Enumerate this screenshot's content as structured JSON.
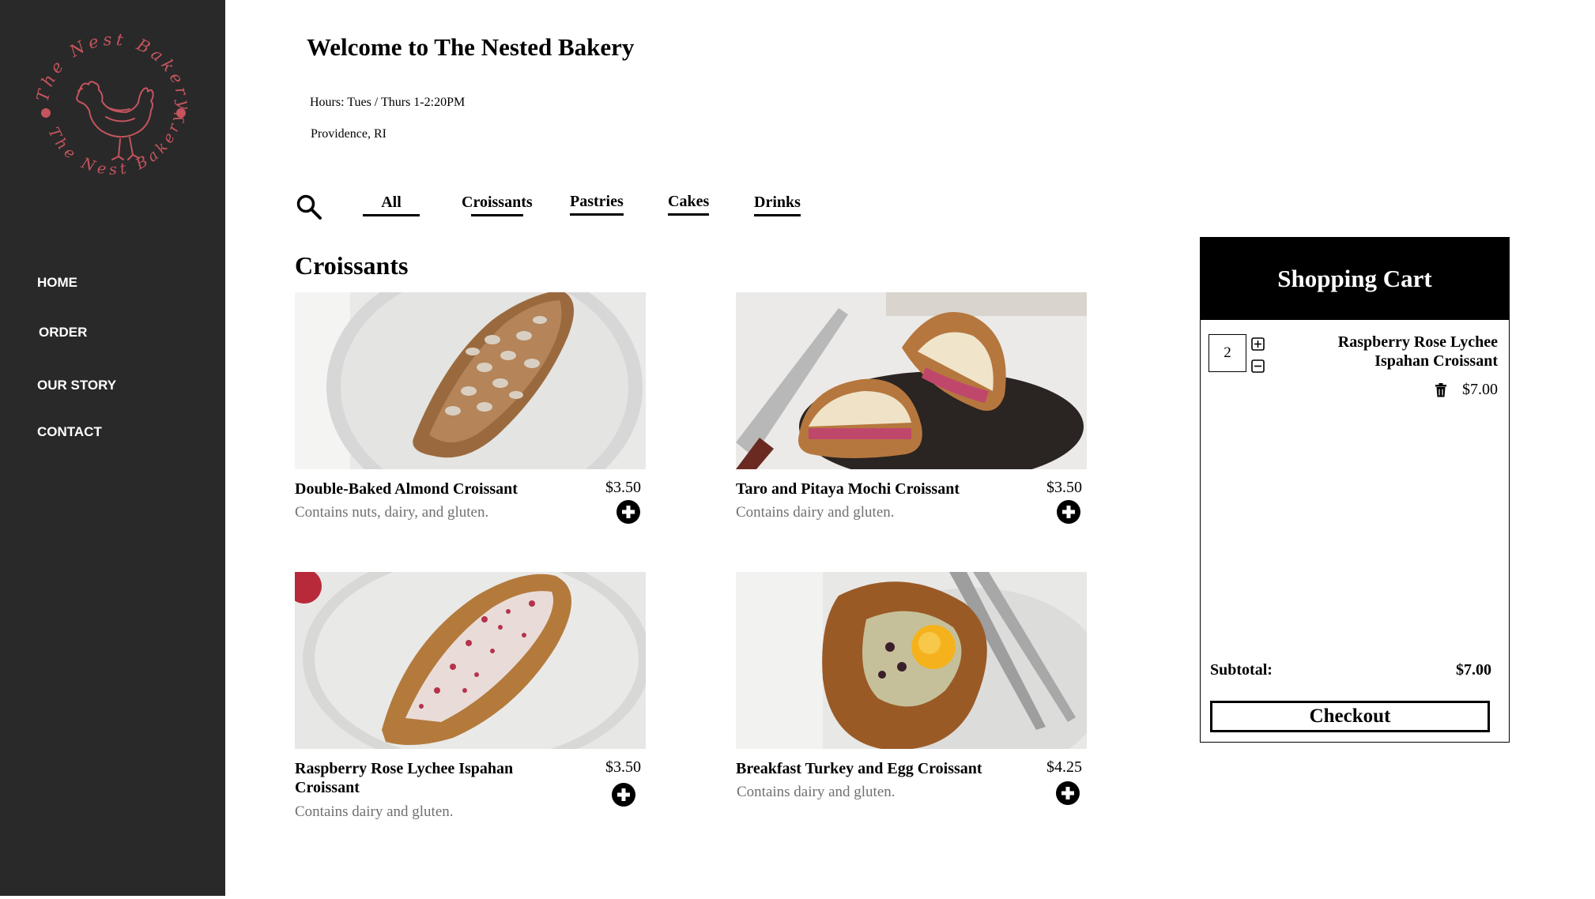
{
  "brand": {
    "logo_text": "The Nest Bakery",
    "accent_color": "#c4545e"
  },
  "sidebar": {
    "bg_color": "#292929",
    "items": [
      {
        "label": "HOME"
      },
      {
        "label": "ORDER"
      },
      {
        "label": "OUR STORY"
      },
      {
        "label": "CONTACT"
      }
    ]
  },
  "header": {
    "title": "Welcome to The Nested Bakery",
    "hours": "Hours: Tues / Thurs 1-2:20PM",
    "location": "Providence, RI"
  },
  "filters": {
    "search_icon": "search-icon",
    "tabs": [
      {
        "label": "All"
      },
      {
        "label": "Croissants"
      },
      {
        "label": "Pastries"
      },
      {
        "label": "Cakes"
      },
      {
        "label": "Drinks"
      }
    ]
  },
  "menu": {
    "section_title": "Croissants",
    "products": [
      {
        "name": "Double-Baked Almond Croissant",
        "price": "$3.50",
        "description": "Contains nuts, dairy, and gluten."
      },
      {
        "name": "Taro and Pitaya Mochi Croissant",
        "price": "$3.50",
        "description": "Contains dairy and gluten."
      },
      {
        "name": "Raspberry Rose Lychee Ispahan Croissant",
        "price": "$3.50",
        "description": "Contains dairy and gluten."
      },
      {
        "name": "Breakfast Turkey and Egg Croissant",
        "price": "$4.25",
        "description": "Contains dairy and gluten."
      }
    ]
  },
  "cart": {
    "title": "Shopping Cart",
    "items": [
      {
        "quantity": "2",
        "name": "Raspberry Rose Lychee Ispahan Croissant",
        "price": "$7.00"
      }
    ],
    "subtotal_label": "Subtotal:",
    "subtotal_value": "$7.00",
    "checkout_label": "Checkout"
  }
}
